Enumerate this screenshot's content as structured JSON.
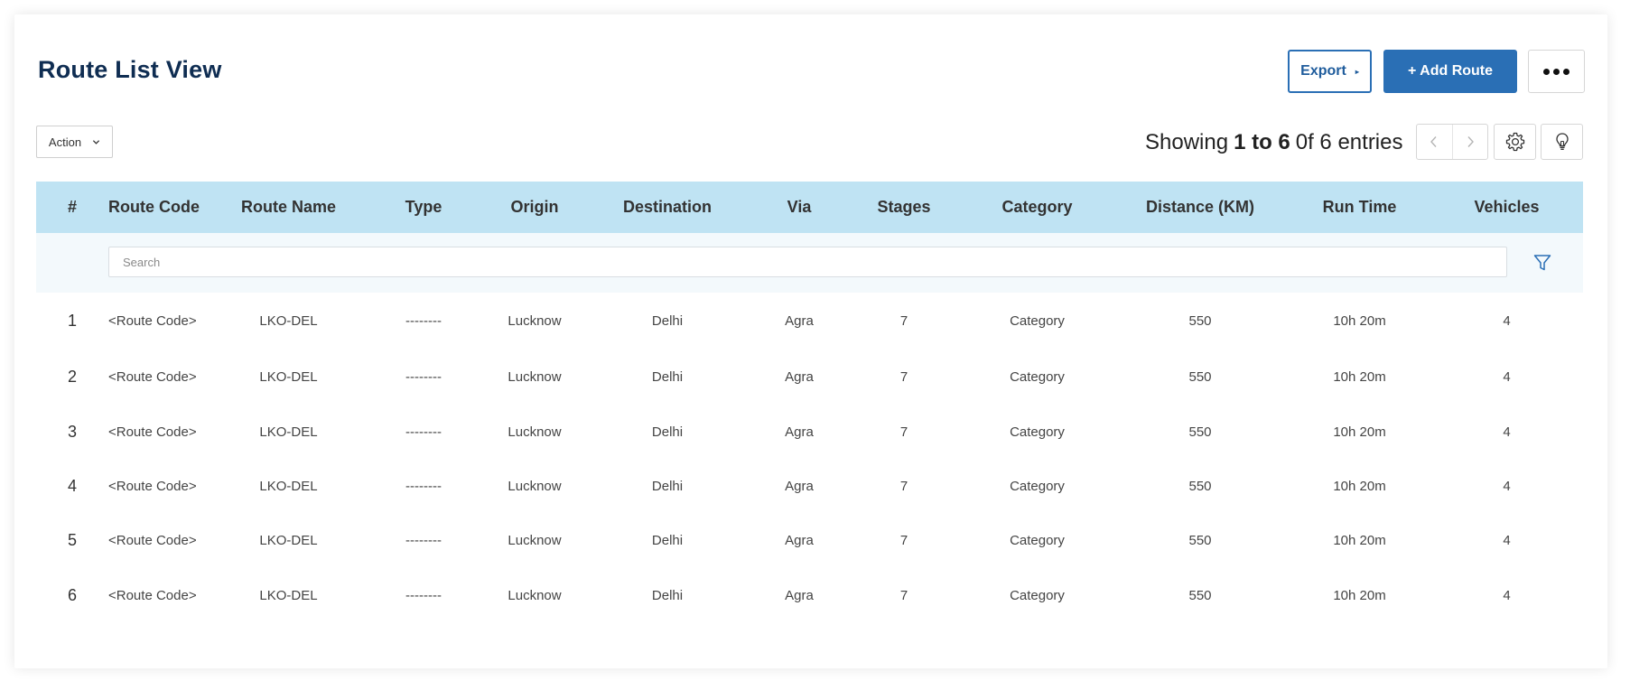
{
  "page": {
    "title": "Route List View"
  },
  "toolbar": {
    "export_label": "Export",
    "add_label": "+ Add Route",
    "action_label": "Action"
  },
  "pagination": {
    "prefix": "Showing",
    "range": "1 to 6",
    "suffix": "0f 6 entries"
  },
  "search": {
    "placeholder": "Search"
  },
  "table": {
    "columns": [
      "#",
      "Route Code",
      "Route Name",
      "Type",
      "Origin",
      "Destination",
      "Via",
      "Stages",
      "Category",
      "Distance (KM)",
      "Run Time",
      "Vehicles"
    ],
    "rows": [
      [
        "1",
        "<Route Code>",
        "LKO-DEL",
        "--------",
        "Lucknow",
        "Delhi",
        "Agra",
        "7",
        "Category",
        "550",
        "10h 20m",
        "4"
      ],
      [
        "2",
        "<Route Code>",
        "LKO-DEL",
        "--------",
        "Lucknow",
        "Delhi",
        "Agra",
        "7",
        "Category",
        "550",
        "10h 20m",
        "4"
      ],
      [
        "3",
        "<Route Code>",
        "LKO-DEL",
        "--------",
        "Lucknow",
        "Delhi",
        "Agra",
        "7",
        "Category",
        "550",
        "10h 20m",
        "4"
      ],
      [
        "4",
        "<Route Code>",
        "LKO-DEL",
        "--------",
        "Lucknow",
        "Delhi",
        "Agra",
        "7",
        "Category",
        "550",
        "10h 20m",
        "4"
      ],
      [
        "5",
        "<Route Code>",
        "LKO-DEL",
        "--------",
        "Lucknow",
        "Delhi",
        "Agra",
        "7",
        "Category",
        "550",
        "10h 20m",
        "4"
      ],
      [
        "6",
        "<Route Code>",
        "LKO-DEL",
        "--------",
        "Lucknow",
        "Delhi",
        "Agra",
        "7",
        "Category",
        "550",
        "10h 20m",
        "4"
      ]
    ]
  },
  "colors": {
    "title": "#0f2d52",
    "primary": "#2a6fb5",
    "header_bg": "#bfe3f3",
    "search_row_bg": "#f3f9fc",
    "filter_icon": "#2a6fb5"
  },
  "icons": {
    "more": "more-dots-icon",
    "action_caret": "chevron-down-icon",
    "prev": "chevron-left-icon",
    "next": "chevron-right-icon",
    "settings": "gear-icon",
    "tips": "lightbulb-icon",
    "filter": "filter-icon"
  }
}
